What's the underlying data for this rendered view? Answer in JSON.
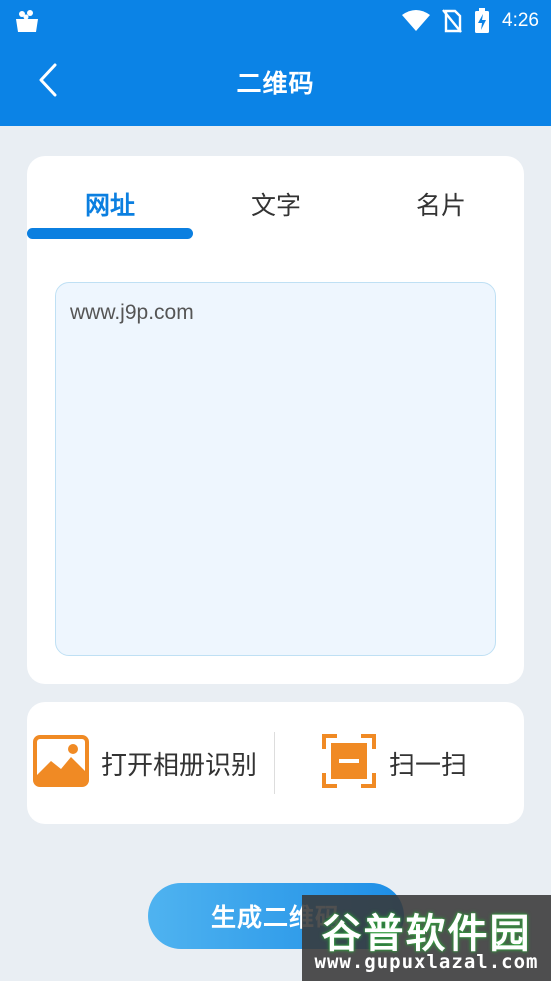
{
  "status_bar": {
    "time": "4:26",
    "icons": [
      "app-notification-icon",
      "wifi-icon",
      "no-sim-icon",
      "battery-charging-icon"
    ]
  },
  "app_bar": {
    "title": "二维码",
    "back_icon": "chevron-left-icon"
  },
  "tabs": [
    {
      "label": "网址",
      "active": true
    },
    {
      "label": "文字",
      "active": false
    },
    {
      "label": "名片",
      "active": false
    }
  ],
  "url_input": {
    "value": "www.j9p.com"
  },
  "actions": {
    "album": {
      "label": "打开相册识别",
      "icon": "image-icon"
    },
    "scan": {
      "label": "扫一扫",
      "icon": "scan-icon"
    }
  },
  "generate_button": {
    "label": "生成二维码"
  },
  "watermark": {
    "text": "谷普软件园",
    "url": "www.gupuxlazal.com"
  },
  "colors": {
    "primary": "#0b83e6",
    "accent_orange": "#f08a24",
    "background": "#e9eef3"
  }
}
